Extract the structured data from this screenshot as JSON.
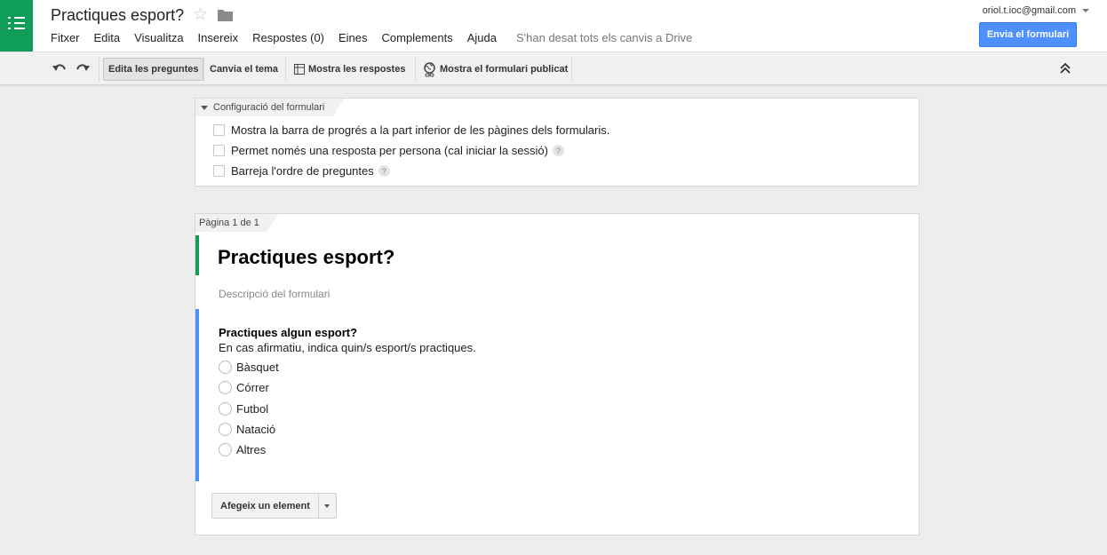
{
  "app": {
    "doc_title": "Practiques esport?",
    "account_email": "oriol.t.ioc@gmail.com",
    "send_button": "Envia el formulari",
    "brand_color": "#0f9d58",
    "accent_color": "#4d90fe"
  },
  "menu": {
    "items": [
      "Fitxer",
      "Edita",
      "Visualitza",
      "Insereix",
      "Respostes (0)",
      "Eines",
      "Complements",
      "Ajuda"
    ],
    "save_status": "S'han desat tots els canvis a Drive"
  },
  "toolbar": {
    "undo_icon": "undo-icon",
    "redo_icon": "redo-icon",
    "edit_questions": "Edita les preguntes",
    "change_theme": "Canvia el tema",
    "view_responses": "Mostra les respostes",
    "view_live_form": "Mostra el formulari publicat",
    "collapse_icon": "collapse-up-icon"
  },
  "settings": {
    "tab_label": "Configuració del formulari",
    "options": [
      {
        "label": "Mostra la barra de progrés a la part inferior de les pàgines dels formularis.",
        "checked": false,
        "help": false
      },
      {
        "label": "Permet només una resposta per persona (cal iniciar la sessió)",
        "checked": false,
        "help": true
      },
      {
        "label": "Barreja l'ordre de preguntes",
        "checked": false,
        "help": true
      }
    ]
  },
  "form": {
    "page_label": "Pàgina 1 de 1",
    "title": "Practiques esport?",
    "description_placeholder": "Descripció del formulari",
    "question": {
      "title": "Practiques algun esport?",
      "help_text": "En cas afirmatiu, indica quin/s esport/s practiques.",
      "options": [
        "Bàsquet",
        "Córrer",
        "Futbol",
        "Natació",
        "Altres"
      ]
    },
    "add_item_button": "Afegeix un element"
  }
}
